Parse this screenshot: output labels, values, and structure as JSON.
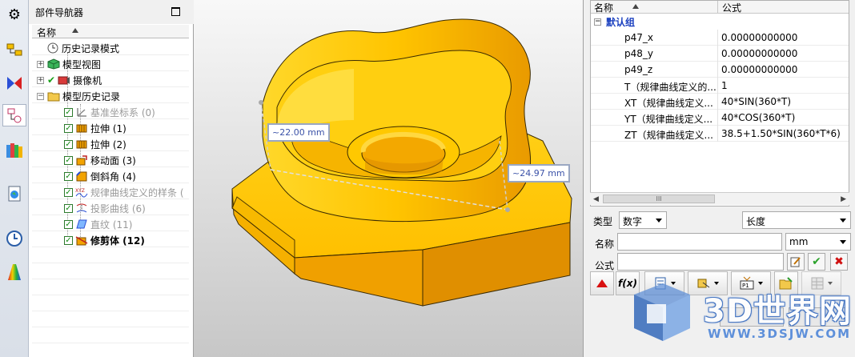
{
  "resource_bar": {
    "icons": [
      "gear-icon",
      "assembly-navigator-icon",
      "constraint-navigator-icon",
      "part-navigator-icon",
      "reuse-library-icon",
      "web-browser-icon",
      "history-icon",
      "roles-icon"
    ]
  },
  "navigator": {
    "title": "部件导航器",
    "column_name": "名称",
    "items": [
      {
        "label": "历史记录模式",
        "icon": "clock-icon",
        "style": "normal"
      },
      {
        "label": "模型视图",
        "icon": "model-views-icon",
        "style": "normal"
      },
      {
        "label": "摄像机",
        "icon": "camera-icon",
        "style": "normal"
      },
      {
        "label": "模型历史记录",
        "icon": "folder-icon",
        "style": "normal"
      },
      {
        "label": "基准坐标系 (0)",
        "icon": "datum-csys-icon",
        "style": "grey"
      },
      {
        "label": "拉伸 (1)",
        "icon": "extrude-icon",
        "style": "normal"
      },
      {
        "label": "拉伸 (2)",
        "icon": "extrude-icon",
        "style": "normal"
      },
      {
        "label": "移动面 (3)",
        "icon": "move-face-icon",
        "style": "normal"
      },
      {
        "label": "倒斜角 (4)",
        "icon": "chamfer-icon",
        "style": "normal"
      },
      {
        "label": "规律曲线定义的样条 (",
        "icon": "law-curve-icon",
        "style": "grey"
      },
      {
        "label": "投影曲线 (6)",
        "icon": "project-curve-icon",
        "style": "grey"
      },
      {
        "label": "直纹 (11)",
        "icon": "ruled-icon",
        "style": "grey"
      },
      {
        "label": "修剪体 (12)",
        "icon": "trim-body-icon",
        "style": "bold"
      }
    ]
  },
  "viewport": {
    "dimension_1": "~22.00 mm",
    "dimension_2": "~24.97 mm"
  },
  "expressions": {
    "col_name": "名称",
    "col_formula": "公式",
    "group": "默认组",
    "rows": [
      {
        "name": "p47_x",
        "formula": "0.00000000000"
      },
      {
        "name": "p48_y",
        "formula": "0.00000000000"
      },
      {
        "name": "p49_z",
        "formula": "0.00000000000"
      },
      {
        "name": "T（规律曲线定义的...",
        "formula": "1"
      },
      {
        "name": "XT（规律曲线定义...",
        "formula": "40*SIN(360*T)"
      },
      {
        "name": "YT（规律曲线定义...",
        "formula": "40*COS(360*T)"
      },
      {
        "name": "ZT（规律曲线定义...",
        "formula": "38.5+1.50*SIN(360*T*6)"
      }
    ],
    "type_label": "类型",
    "type_value": "数字",
    "dimension_value": "长度",
    "name_label": "名称",
    "unit_value": "mm",
    "formula_label": "公式",
    "scroll_thumb": "III"
  },
  "watermark": {
    "brand": "3D世界网",
    "url": "WWW.3DSJW.COM"
  },
  "colors": {
    "part_face": "#ffc400",
    "part_side": "#f2a000",
    "part_dark": "#c98000",
    "group_text": "#1a3fbf"
  }
}
